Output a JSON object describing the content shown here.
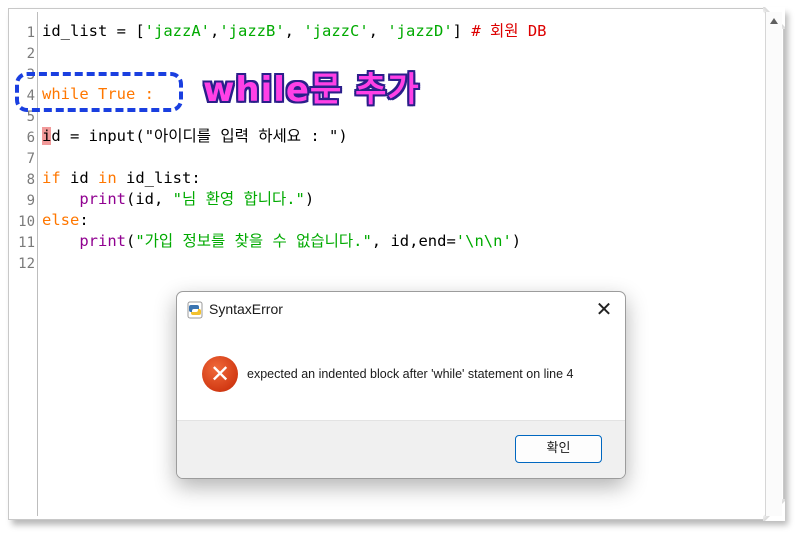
{
  "editor": {
    "line_numbers": [
      "1",
      "2",
      "3",
      "4",
      "5",
      "6",
      "7",
      "8",
      "9",
      "10",
      "11",
      "12"
    ],
    "lines": {
      "l1": {
        "id_list": "id_list = [",
        "s1": "'jazzA'",
        "c1": ",",
        "s2": "'jazzB'",
        "c2": ", ",
        "s3": "'jazzC'",
        "c3": ", ",
        "s4": "'jazzD'",
        "close": "] ",
        "comment": "# 회원 DB"
      },
      "l4": {
        "kw": "while",
        "rest": " True :"
      },
      "l6": {
        "cursor": "i",
        "a": "d = ",
        "fn": "input",
        "paren": "(",
        "str": "\"아이디를 입력 하세요 : \"",
        "end": ")"
      },
      "l8": {
        "kw1": "if",
        "a": " id ",
        "kw2": "in",
        "b": " id_list:"
      },
      "l9": {
        "indent": "    ",
        "fn": "print",
        "a": "(id, ",
        "str": "\"님 환영 합니다.\"",
        "end": ")"
      },
      "l10": {
        "kw": "else",
        "rest": ":"
      },
      "l11": {
        "indent": "    ",
        "fn": "print",
        "paren": "(",
        "str": "\"가입 정보를 찾을 수 없습니다.\"",
        "a": ", id,end=",
        "str2": "'\\n\\n'",
        "end": ")"
      }
    }
  },
  "annotation": {
    "text": "while문 추가"
  },
  "dialog": {
    "title": "SyntaxError",
    "close_glyph": "✕",
    "error_glyph": "✕",
    "message": "expected an indented block after 'while' statement on line 4",
    "ok_label": "확인"
  },
  "colors": {
    "keyword": "#ff7700",
    "string": "#00aa00",
    "comment": "#dd0000",
    "builtin": "#900090",
    "annotation_fill": "#ff40e6",
    "annotation_box": "#1a3fe0",
    "error_icon": "#d23a14",
    "ok_button_border": "#0067c0"
  },
  "icons": [
    "python-icon",
    "close-icon",
    "error-icon"
  ]
}
